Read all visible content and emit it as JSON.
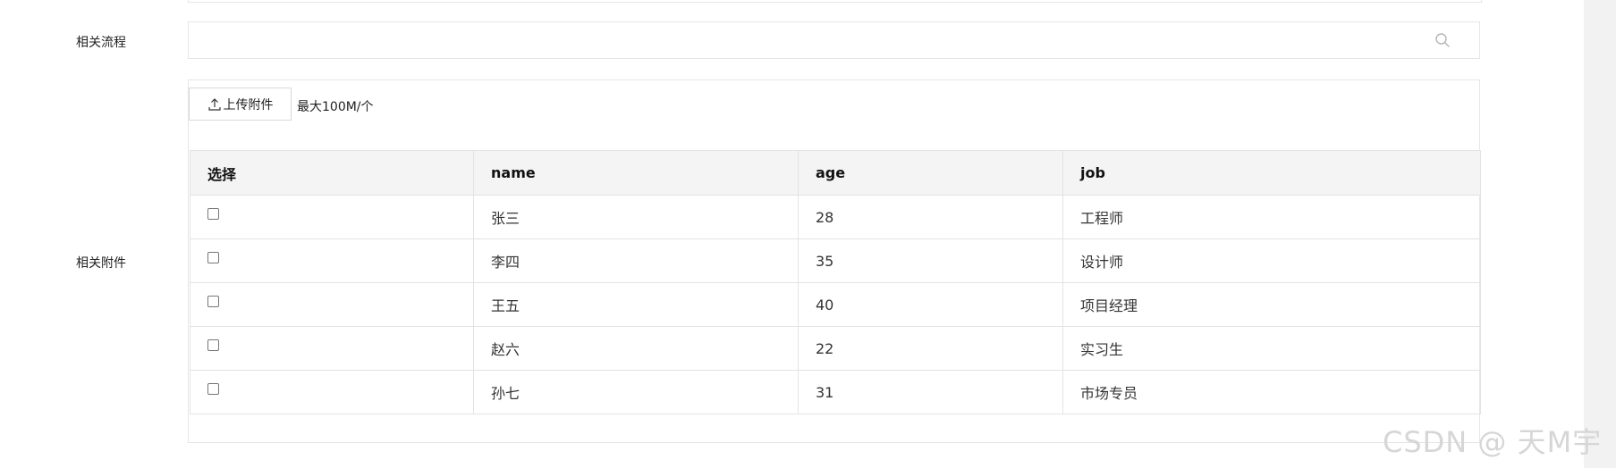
{
  "form": {
    "flow_label": "相关流程",
    "attach_label": "相关附件",
    "flow_input_value": ""
  },
  "upload": {
    "button_label": "上传附件",
    "size_hint": "最大100M/个"
  },
  "table": {
    "headers": [
      "选择",
      "name",
      "age",
      "job"
    ],
    "rows": [
      {
        "name": "张三",
        "age": "28",
        "job": "工程师"
      },
      {
        "name": "李四",
        "age": "35",
        "job": "设计师"
      },
      {
        "name": "王五",
        "age": "40",
        "job": "项目经理"
      },
      {
        "name": "赵六",
        "age": "22",
        "job": "实习生"
      },
      {
        "name": "孙七",
        "age": "31",
        "job": "市场专员"
      }
    ]
  },
  "watermark": "CSDN @ 天M宇",
  "icons": {
    "search": "search-icon",
    "upload": "upload-icon"
  }
}
